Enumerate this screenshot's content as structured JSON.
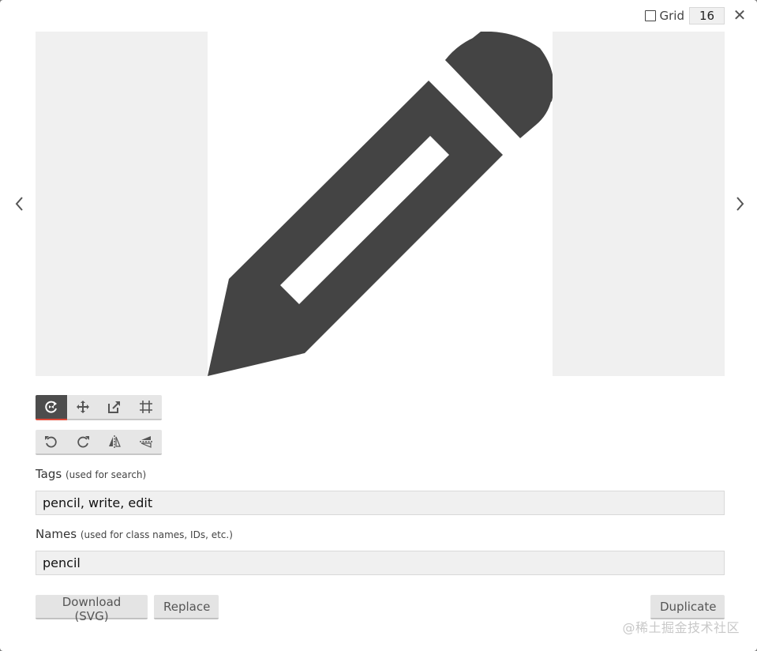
{
  "grid": {
    "label": "Grid",
    "checked": false,
    "size": "16"
  },
  "dialog": {
    "close_symbol": "✕"
  },
  "preview": {
    "icon": "pencil-icon",
    "background_color": "#f0f0f0",
    "icon_color": "#444444"
  },
  "toolbar_transform": {
    "tools": [
      {
        "name": "rotate-mode-icon",
        "active": true
      },
      {
        "name": "move-mode-icon",
        "active": false
      },
      {
        "name": "resize-mode-icon",
        "active": false
      },
      {
        "name": "crop-mode-icon",
        "active": false
      }
    ],
    "active_color": "#4d4d4d",
    "active_underline": "#e04b3a"
  },
  "toolbar_actions": {
    "tools": [
      {
        "name": "rotate-left-icon"
      },
      {
        "name": "rotate-right-icon"
      },
      {
        "name": "flip-horizontal-icon"
      },
      {
        "name": "flip-vertical-icon"
      }
    ]
  },
  "tags": {
    "label": "Tags",
    "hint": "(used for search)",
    "value": "pencil, write, edit"
  },
  "names": {
    "label": "Names",
    "hint": "(used for class names, IDs, etc.)",
    "value": "pencil"
  },
  "buttons": {
    "download": "Download (SVG)",
    "replace": "Replace",
    "duplicate": "Duplicate"
  },
  "watermark": "@稀土掘金技术社区"
}
